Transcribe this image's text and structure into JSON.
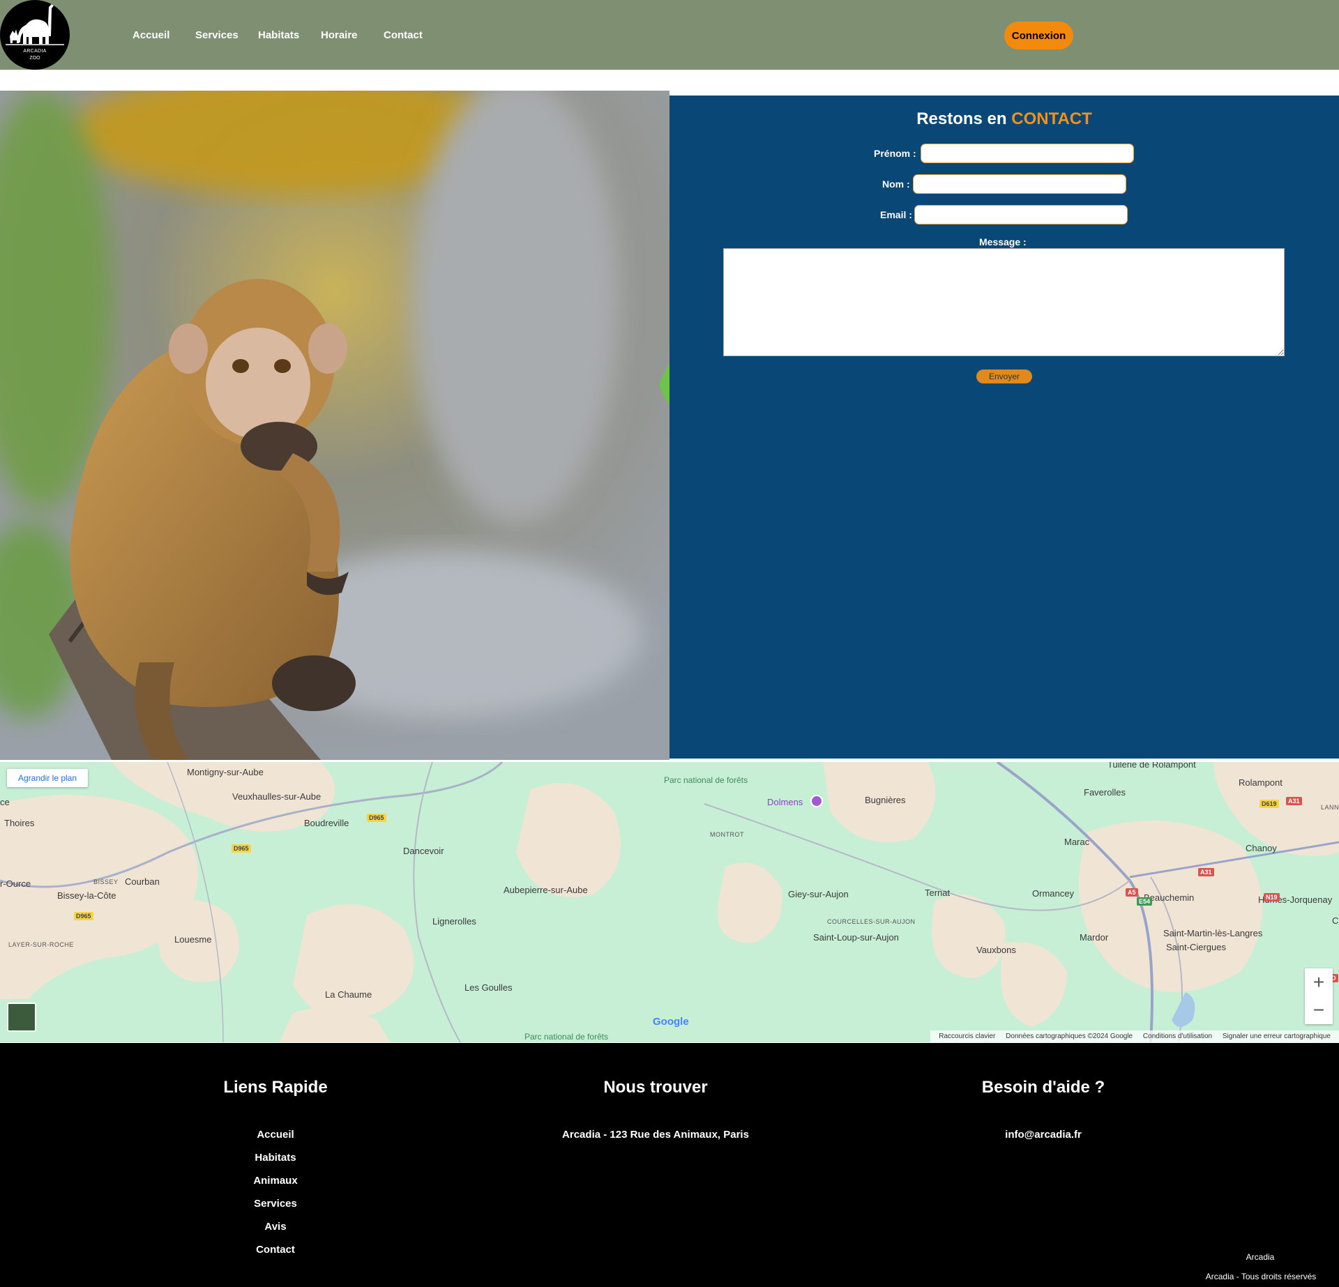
{
  "header": {
    "logo": {
      "line1": "ARCADIA",
      "line2": "ZOO"
    },
    "nav": [
      "Accueil",
      "Services",
      "Habitats",
      "Horaire",
      "Contact"
    ],
    "login_label": "Connexion"
  },
  "contact": {
    "title_prefix": "Restons en",
    "title_accent": "CONTACT",
    "labels": {
      "first_name": "Prénom :",
      "last_name": "Nom :",
      "email": "Email :",
      "message": "Message :"
    },
    "values": {
      "first_name": "",
      "last_name": "",
      "email": "",
      "message": ""
    },
    "submit_label": "Envoyer"
  },
  "map": {
    "enlarge_label": "Agrandir le plan",
    "labels": [
      "Montigny-sur-Aube",
      "Veuxhaulles-sur-Aube",
      "Boudreville",
      "Thoires",
      "Dancevoir",
      "Courban",
      "Bissey-la-Côte",
      "BISSEY",
      "r-Ource",
      "Aubepierre-sur-Aube",
      "Lignerolles",
      "Louesme",
      "LAYER-SUR-ROCHE",
      "La Chaume",
      "Les Goulles",
      "Parc national de forêts",
      "Parc national de forêts",
      "Dolmens",
      "Bugnières",
      "MONTROT",
      "Giey-sur-Aujon",
      "Ternat",
      "COURCELLES-SUR-AUJON",
      "Saint-Loup-sur-Aujon",
      "Vauxbons",
      "Faverolles",
      "Marac",
      "Ormancey",
      "Mardor",
      "Beauchemin",
      "Saint-Martin-lès-Langres",
      "Saint-Ciergues",
      "Rolampont",
      "Chanoy",
      "Humes-Jorquenay",
      "Tuilerie de Rolampont",
      "ce",
      "LANN",
      "C"
    ],
    "roads": [
      "D965",
      "D965",
      "D965",
      "D619",
      "A31",
      "A31",
      "A5",
      "E54",
      "N19",
      "D"
    ],
    "google": "Google",
    "footer": [
      "Raccourcis clavier",
      "Données cartographiques ©2024 Google",
      "Conditions d'utilisation",
      "Signaler une erreur cartographique"
    ],
    "zoom_in": "+",
    "zoom_out": "−"
  },
  "footer": {
    "quick_links_title": "Liens Rapide",
    "quick_links": [
      "Accueil",
      "Habitats",
      "Animaux",
      "Services",
      "Avis",
      "Contact"
    ],
    "find_us_title": "Nous trouver",
    "address": "Arcadia - 123 Rue des Animaux, Paris",
    "help_title": "Besoin d'aide ?",
    "email": "info@arcadia.fr",
    "brand": "Arcadia",
    "rights": "Arcadia - Tous droits réservés"
  },
  "colors": {
    "header_bg": "#7f8f72",
    "accent": "#f38a0b",
    "contact_bg": "#094876",
    "footer_bg": "#000000"
  }
}
